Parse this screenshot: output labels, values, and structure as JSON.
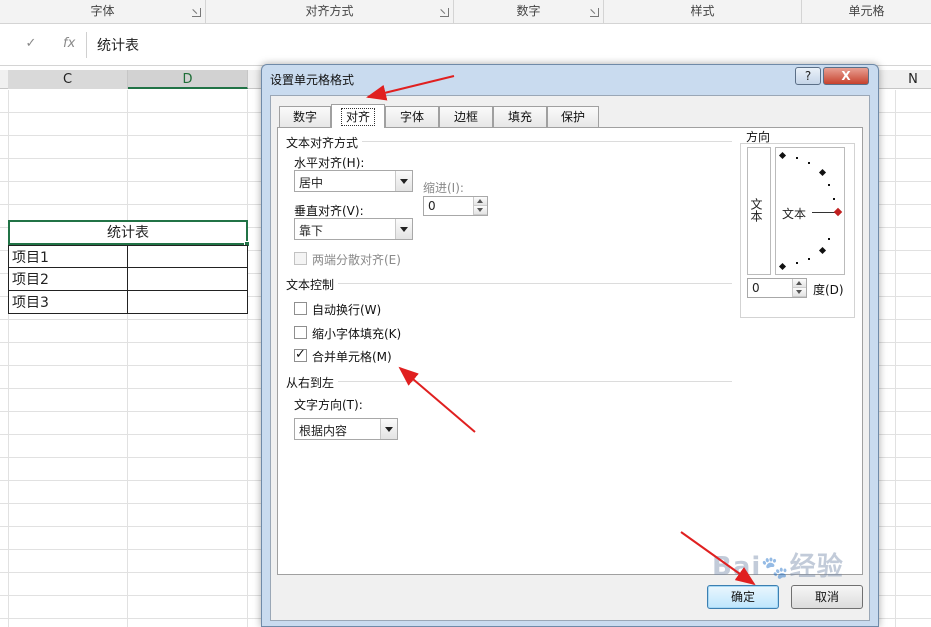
{
  "ribbon": {
    "groups": [
      {
        "label": "字体",
        "launcher": true
      },
      {
        "label": "对齐方式",
        "launcher": true
      },
      {
        "label": "数字",
        "launcher": true
      },
      {
        "label": "样式",
        "launcher": false
      },
      {
        "label": "单元格",
        "launcher": false
      }
    ]
  },
  "formula_bar": {
    "cancel_icon": "✓",
    "fx_icon": "fx",
    "content": "统计表"
  },
  "columns": [
    "C",
    "D",
    "N"
  ],
  "sheet": {
    "merged_title": "统计表",
    "rows": [
      "项目1",
      "项目2",
      "项目3"
    ]
  },
  "dialog": {
    "title": "设置单元格格式",
    "help_label": "?",
    "close_label": "X",
    "tabs": [
      "数字",
      "对齐",
      "字体",
      "边框",
      "填充",
      "保护"
    ],
    "active_tab": "对齐",
    "text_alignment": {
      "section": "文本对齐方式",
      "horizontal_label": "水平对齐(H):",
      "horizontal_value": "居中",
      "indent_label": "缩进(I):",
      "indent_value": "0",
      "vertical_label": "垂直对齐(V):",
      "vertical_value": "靠下",
      "distributed_label": "两端分散对齐(E)"
    },
    "text_control": {
      "section": "文本控制",
      "wrap_label": "自动换行(W)",
      "wrap_checked": false,
      "shrink_label": "缩小字体填充(K)",
      "shrink_checked": false,
      "merge_label": "合并单元格(M)",
      "merge_checked": true
    },
    "rtl": {
      "section": "从右到左",
      "direction_label": "文字方向(T):",
      "direction_value": "根据内容"
    },
    "orientation": {
      "section": "方向",
      "vertical_text": "文本",
      "dial_text": "文本",
      "degree_value": "0",
      "degree_label": "度(D)"
    },
    "ok_label": "确定",
    "cancel_label": "取消"
  },
  "watermark": "Baidu经验",
  "colors": {
    "excel_green": "#217346",
    "annotation_red": "#e02020",
    "dialog_frame": "#c9dbef"
  }
}
